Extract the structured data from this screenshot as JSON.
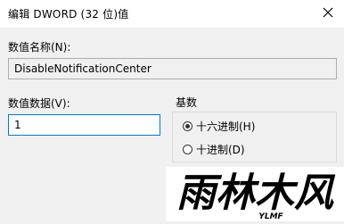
{
  "window": {
    "title": "编辑 DWORD (32 位)值"
  },
  "value_name": {
    "label": "数值名称(N):",
    "value": "DisableNotificationCenter"
  },
  "value_data": {
    "label": "数值数据(V):",
    "value": "1"
  },
  "base": {
    "title": "基数",
    "options": [
      {
        "label": "十六进制(H)",
        "checked": true
      },
      {
        "label": "十进制(D)",
        "checked": false
      }
    ]
  },
  "watermark": {
    "text": "雨林木风",
    "subtext": "YLMF"
  }
}
